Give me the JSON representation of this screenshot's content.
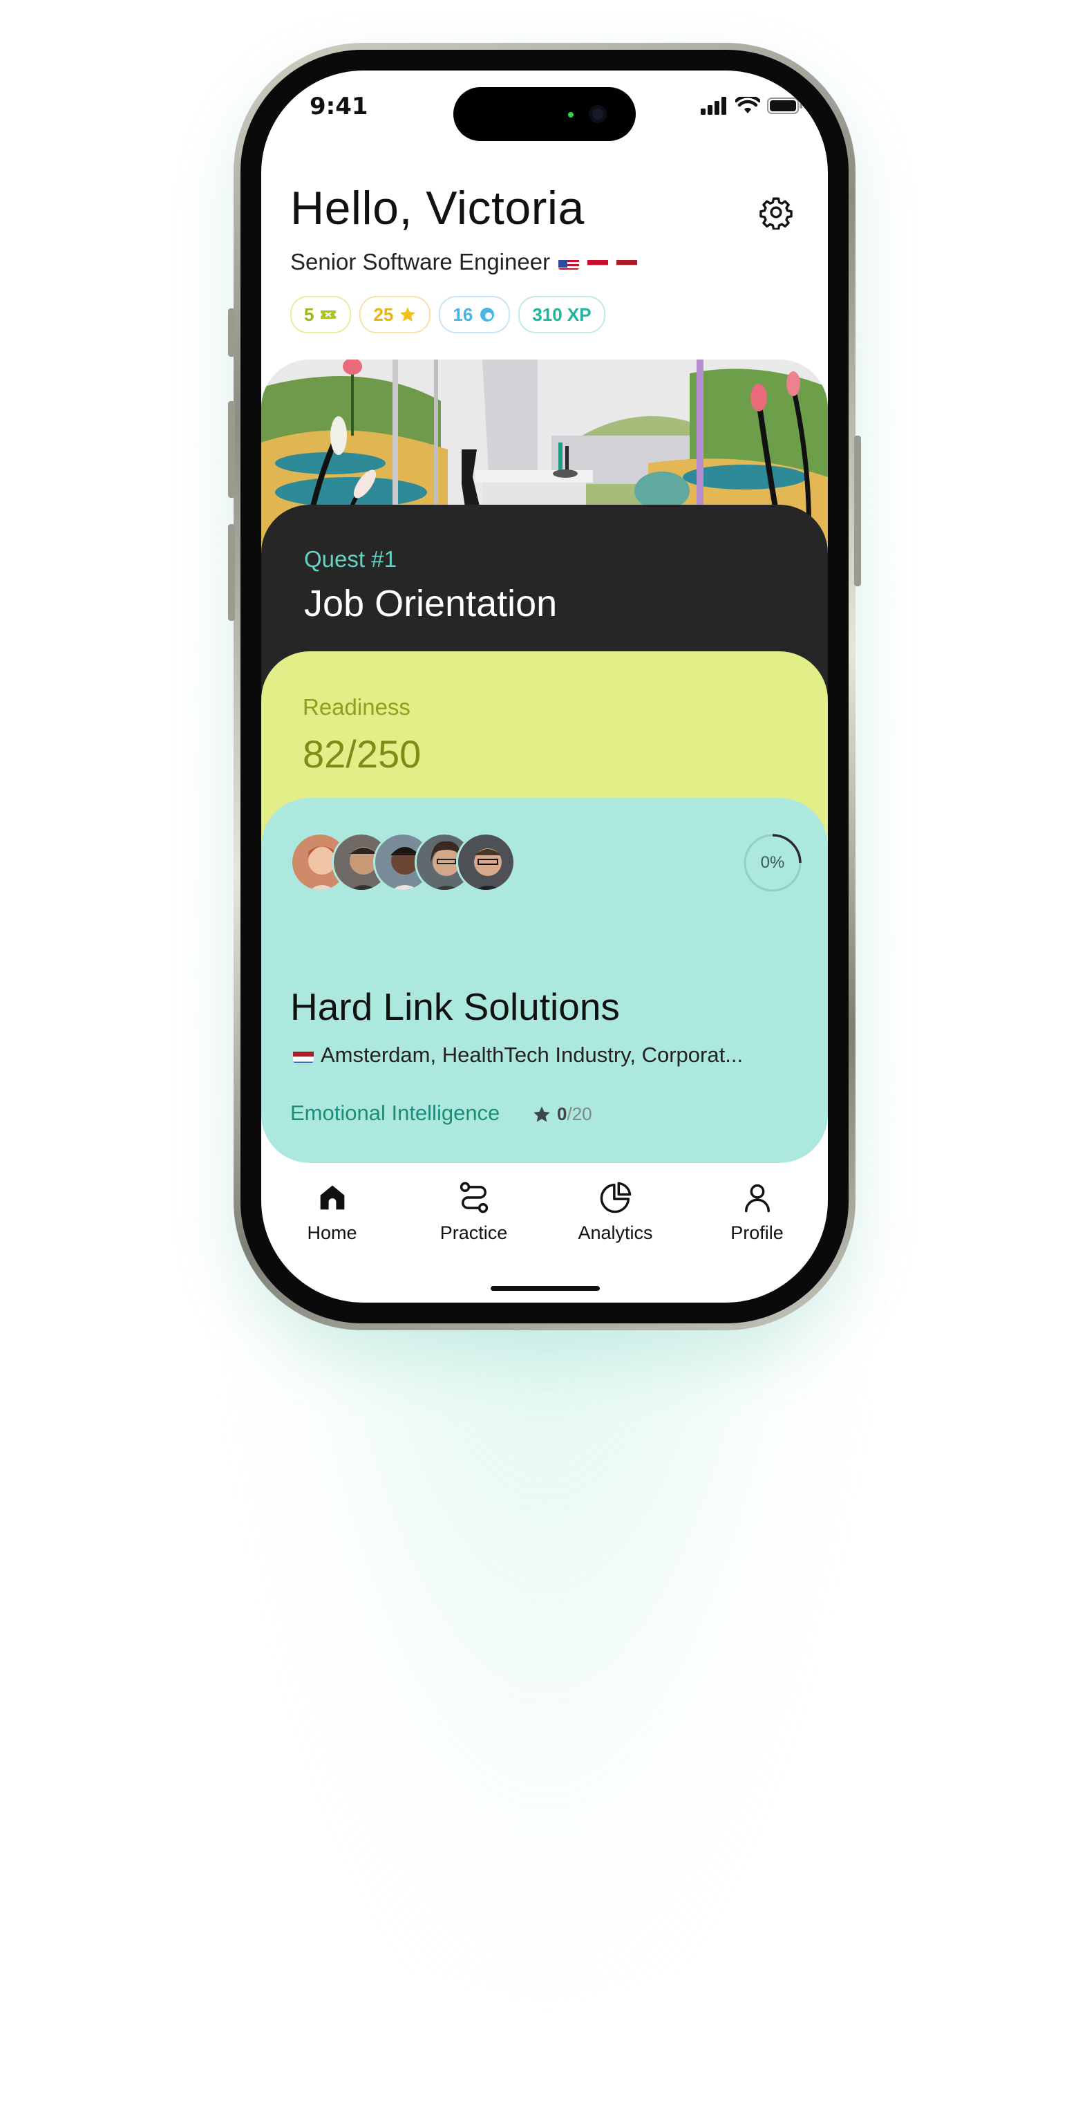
{
  "status_bar": {
    "time": "9:41"
  },
  "header": {
    "greeting": "Hello, Victoria",
    "role": "Senior Software Engineer",
    "flags": [
      "us-flag-icon",
      "austria-flag-icon",
      "netherlands-flag-icon"
    ]
  },
  "stats": [
    {
      "value": "5",
      "icon": "ticket-icon",
      "color": "#9ab51e",
      "border": "#e5ef9b"
    },
    {
      "value": "25",
      "icon": "star-icon",
      "color": "#e6b313",
      "border": "#f6e3a6"
    },
    {
      "value": "16",
      "icon": "spinner-icon",
      "color": "#4ab4e6",
      "border": "#c6e6f6"
    },
    {
      "value": "310 XP",
      "icon": "",
      "color": "#1fb59c",
      "border": "#bfece3"
    }
  ],
  "quest": {
    "label": "Quest #1",
    "title": "Job Orientation"
  },
  "readiness": {
    "label": "Readiness",
    "value": "82/250"
  },
  "company_card": {
    "progress": "0%",
    "name": "Hard Link Solutions",
    "location": "Amsterdam, HealthTech Industry, Corporat...",
    "skill": "Emotional Intelligence",
    "score": "0",
    "score_total": "/20"
  },
  "nav": {
    "items": [
      {
        "label": "Home",
        "icon": "home-icon"
      },
      {
        "label": "Practice",
        "icon": "route-icon"
      },
      {
        "label": "Analytics",
        "icon": "pie-chart-icon"
      },
      {
        "label": "Profile",
        "icon": "user-icon"
      }
    ]
  },
  "colors": {
    "accent_teal": "#65d2c2",
    "card_dark": "#262626",
    "card_yellow": "#e2ef88",
    "card_teal": "#ade8de"
  }
}
